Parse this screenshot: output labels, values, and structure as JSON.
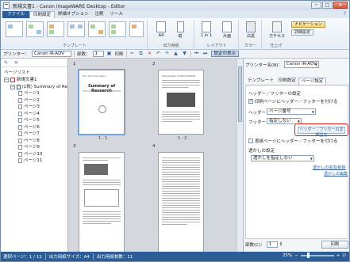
{
  "window": {
    "title": "新規文書1 - Canon imageWARE Desktop - Editor",
    "controls": [
      "─",
      "□",
      "✕"
    ]
  },
  "ribbon_tabs": [
    "ファイル",
    "印刷設定",
    "詳細オプション",
    "注釈",
    "ツール"
  ],
  "ribbon_help": "?",
  "ribbon": {
    "group_template": "テンプレート",
    "group_paper": "出力用紙",
    "group_layout": "レイアウト",
    "group_color": "カラー",
    "group_finish": "仕上げ",
    "btn_a4": "A4",
    "btn_portrait": "縦",
    "btn_1in1": "1 in 1",
    "btn_1in1_sub": "(標準)",
    "btn_single": "片面",
    "btn_bw": "白黒",
    "btn_staple": "ホチキス",
    "navigation": "ナビゲーション",
    "detail_settings": "詳細設定"
  },
  "toolbar": {
    "printer_label": "プリンター：",
    "printer_value": "Canon iR-ADV",
    "copies_label": "部数：",
    "copies_value": "1",
    "print_label": "印刷",
    "show_settings": "設定の表示"
  },
  "left_panel": {
    "header": "ページリスト",
    "root": "新規文書1",
    "document": "(1枚) Summary of Re",
    "pages": [
      "ページ1",
      "ページ2",
      "ページ3",
      "ページ4",
      "ページ5",
      "ページ6",
      "ページ7",
      "ページ8",
      "ページ9",
      "ページ10",
      "ページ11"
    ]
  },
  "preview": {
    "page_numbers": [
      "1",
      "2",
      "3",
      "4"
    ],
    "page_labels": [
      "1 - 1",
      "1 - 2"
    ],
    "page1_header": "Pro. XX Corporation",
    "page1_title": "Summary of Research",
    "page1_sub": "Title of the development of XXXXXXXXXX",
    "page2_header": "Introduction of XXX XXXXXX"
  },
  "right_panel": {
    "printer_label": "プリンター名(N)：",
    "printer_value": "Canon iR-ADV",
    "tabs": [
      "テンプレート",
      "印刷設定",
      "ページ設定"
    ],
    "sec_header_footer": "ヘッダー／フッターの設定",
    "chk_print_hf": "印刷ページにヘッダー／フッターを付ける",
    "header_label": "ヘッダー：",
    "header_value": "ページ番号",
    "footer_label": "フッター：",
    "footer_value": "指定しない",
    "detail_button": "ヘッダー／フッターの詳細設定",
    "chk_blank": "差紙ページにヘッダー／フッターを付ける",
    "sec_watermark": "透かしの設定",
    "watermark_value": "透かしを指定しない",
    "link_add_watermark": "透かしの追加/削除",
    "link_edit_watermark": "透かしの編集",
    "copies_label": "部数(C)：",
    "copies_value": "1",
    "print_button": "印刷"
  },
  "status": {
    "selection": "選択ページ：1 / 11",
    "paper_size": "出力用紙サイズ：A4",
    "paper_count": "出力用紙枚数：11",
    "zoom": "25%"
  },
  "colors": {
    "accent": "#2c5d96",
    "highlight": "#e01818"
  }
}
